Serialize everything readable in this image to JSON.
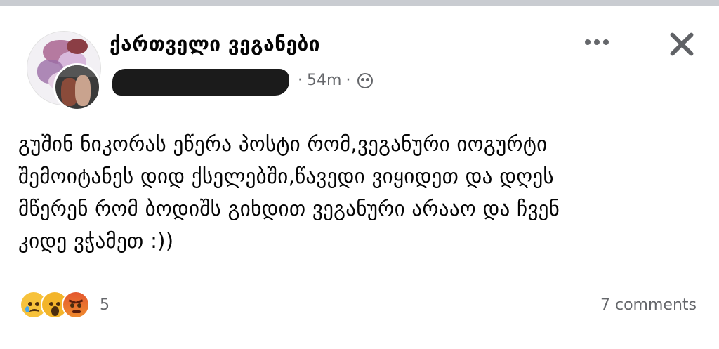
{
  "post": {
    "group_name": "ქართველი ვეგანები",
    "timestamp": "54m",
    "separator": "·",
    "audience_icon": "group-audience-icon",
    "text_lines": [
      "გუშინ ნიკორას ეწერა პოსტი რომ,ვეგანური იოგურტი",
      "შემოიტანეს დიდ ქსელებში,წავედი ვიყიდეთ და დღეს",
      "მწერენ რომ ბოდიშს გიხდით ვეგანური არააო და ჩვენ",
      "კიდე ვჭამეთ :))"
    ],
    "reactions": {
      "icons": [
        "sad-reaction-icon",
        "wow-reaction-icon",
        "angry-reaction-icon"
      ],
      "count": "5"
    },
    "comments_label": "7 comments"
  },
  "colors": {
    "secondary_text": "#65676b",
    "primary_text": "#050505",
    "top_bar": "#c9ccd1"
  }
}
